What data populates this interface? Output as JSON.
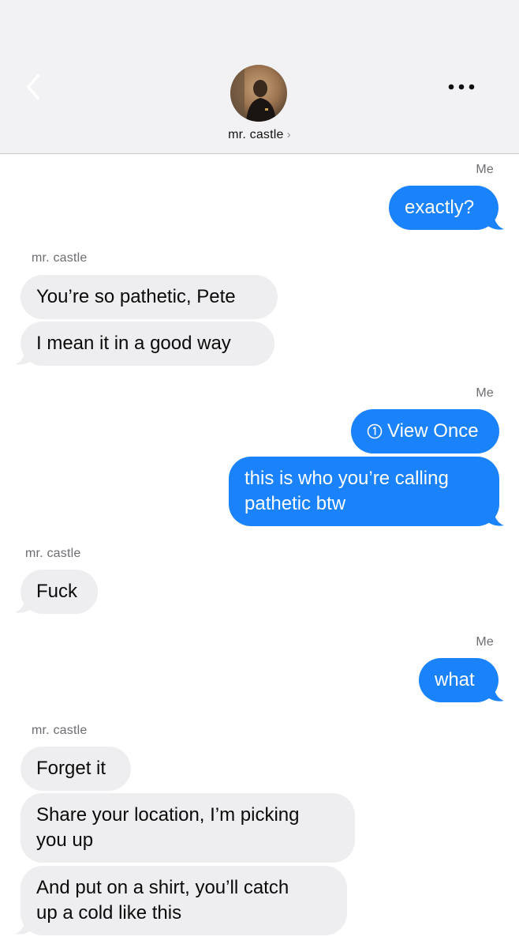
{
  "header": {
    "contact_name": "mr. castle",
    "chevron": "›",
    "back_icon": "chevron-left-icon",
    "more_icon": "ellipsis-icon"
  },
  "colors": {
    "outgoing": "#1a82fb",
    "incoming": "#eeeef0",
    "header_bg": "#f2f2f4"
  },
  "messages": {
    "sender_me_1": "Me",
    "m1": "exactly?",
    "sender_them_1": "mr. castle",
    "m2": "You’re so pathetic, Pete",
    "m3": "I mean it in a good way",
    "sender_me_2": "Me",
    "m4": "View Once",
    "m5_line1": "this is who you’re calling",
    "m5_line2": "pathetic btw",
    "sender_them_2": "mr. castle",
    "m6": "Fuck",
    "sender_me_3": "Me",
    "m7": "what",
    "sender_them_3": "mr. castle",
    "m8": "Forget it",
    "m9_line1": "Share your location, I’m picking",
    "m9_line2": "you up",
    "m10_line1": "And put on a shirt, you’ll catch",
    "m10_line2": "up a cold like this"
  }
}
